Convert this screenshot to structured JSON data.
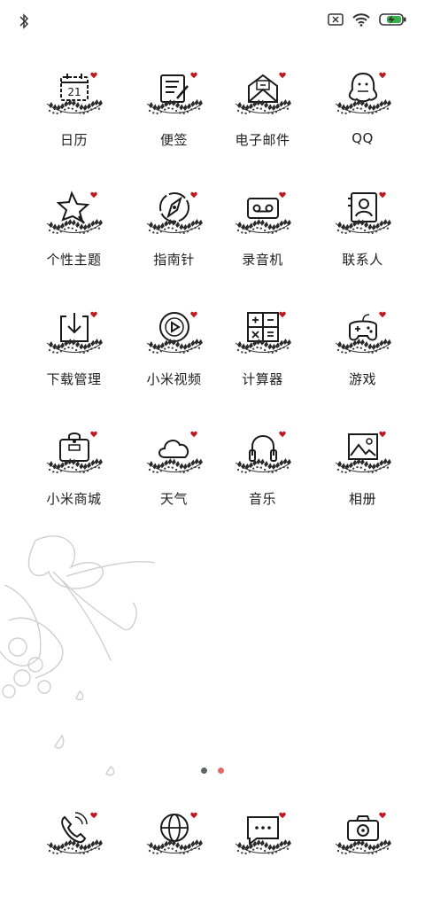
{
  "status": {
    "left_icons": [
      "bluetooth-icon"
    ],
    "right_icons": [
      "sim-none-icon",
      "wifi-icon",
      "battery-charging-icon"
    ],
    "battery_color": "#38b14a"
  },
  "apps": [
    {
      "label": "日历",
      "icon": "calendar-icon",
      "day": "21"
    },
    {
      "label": "便签",
      "icon": "notes-icon"
    },
    {
      "label": "电子邮件",
      "icon": "mail-icon"
    },
    {
      "label": "QQ",
      "icon": "qq-icon"
    },
    {
      "label": "个性主题",
      "icon": "themes-icon"
    },
    {
      "label": "指南针",
      "icon": "compass-icon"
    },
    {
      "label": "录音机",
      "icon": "recorder-icon"
    },
    {
      "label": "联系人",
      "icon": "contacts-icon"
    },
    {
      "label": "下载管理",
      "icon": "downloads-icon"
    },
    {
      "label": "小米视频",
      "icon": "video-icon"
    },
    {
      "label": "计算器",
      "icon": "calculator-icon"
    },
    {
      "label": "游戏",
      "icon": "game-icon"
    },
    {
      "label": "小米商城",
      "icon": "store-icon"
    },
    {
      "label": "天气",
      "icon": "weather-icon"
    },
    {
      "label": "音乐",
      "icon": "music-icon"
    },
    {
      "label": "相册",
      "icon": "gallery-icon"
    }
  ],
  "dock": [
    {
      "icon": "phone-icon"
    },
    {
      "icon": "browser-icon"
    },
    {
      "icon": "messages-icon"
    },
    {
      "icon": "camera-icon"
    }
  ],
  "page_indicator": {
    "count": 2,
    "active_index": 1,
    "inactive_color": "#5b6660",
    "active_color": "#e06a6a"
  },
  "colors": {
    "heart": "#c0181f",
    "icon_stroke": "#1a1a1a"
  }
}
